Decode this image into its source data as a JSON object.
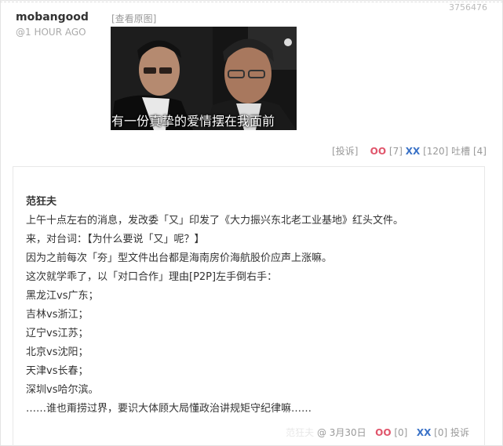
{
  "post": {
    "id": "3756476",
    "author": "mobangood",
    "time": "@1 HOUR AGO",
    "view_original": "[查看原图]",
    "subtitle": "有一份真挚的爱情摆在我面前",
    "report": "[投诉]",
    "oo_label": "OO",
    "oo_count": "[7]",
    "xx_label": "XX",
    "xx_count": "[120]",
    "tucao": "吐槽 [4]"
  },
  "comment": {
    "author": "范狂夫",
    "lines": [
      "上午十点左右的消息，发改委「又」印发了《大力振兴东北老工业基地》红头文件。",
      "来，对台词：【为什么要说「又」呢？】",
      "因为之前每次「夯」型文件出台都是海南房价海航股价应声上涨嘛。",
      "这次就学乖了，以「对口合作」理由[P2P]左手倒右手：",
      "黑龙江vs广东；",
      "吉林vs浙江；",
      "辽宁vs江苏；",
      "北京vs沈阳；",
      "天津vs长春；",
      "深圳vs哈尔滨。",
      "……谁也甭捞过界，要识大体顾大局懂政治讲规矩守纪律嘛……"
    ],
    "faded_author": "范狂夫",
    "date": "@ 3月30日",
    "oo_label": "OO",
    "oo_count": "[0]",
    "xx_label": "XX",
    "xx_count": "[0]",
    "report": "投诉"
  }
}
